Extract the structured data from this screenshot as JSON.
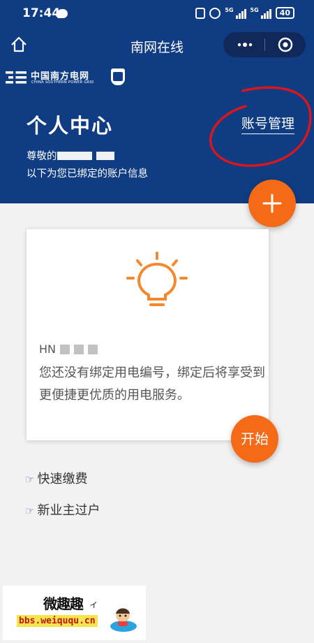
{
  "status_bar": {
    "time": "17:44",
    "network_1": "5G",
    "network_2": "5G",
    "battery": "40"
  },
  "navbar": {
    "title": "南网在线",
    "home_icon": "home-icon",
    "more_icon": "more-icon",
    "close_icon": "target-icon"
  },
  "logo": {
    "cn": "中国南方电网",
    "en": "CHINA SOUTHERN POWER GRID"
  },
  "header": {
    "title": "个人中心",
    "account_link": "账号管理",
    "greeting": "尊敬的",
    "subtitle": "以下为您已绑定的账户信息"
  },
  "card": {
    "icon": "bulb-icon",
    "account_prefix": "HN",
    "message": "您还没有绑定用电编号，绑定后将享受到更便捷更优质的用电服务。",
    "start_label": "开始"
  },
  "links": [
    {
      "label": "快速缴费"
    },
    {
      "label": "新业主过户"
    }
  ],
  "watermark": {
    "title": "微趣趣",
    "url": "bbs.weiququ.cn"
  },
  "colors": {
    "brand_blue": "#0f3c82",
    "accent_orange": "#f56a16",
    "annotation_red": "#d8161e"
  }
}
